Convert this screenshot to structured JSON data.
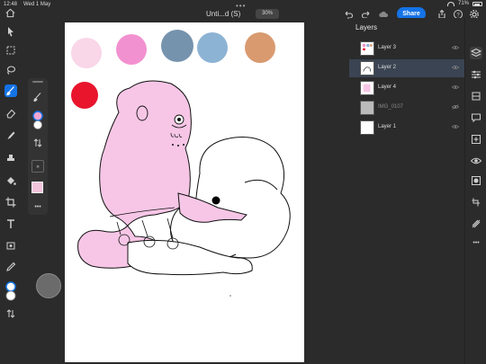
{
  "status": {
    "time": "12:48",
    "date": "Wed 1 May",
    "battery": "71%"
  },
  "header": {
    "doc_title": "Unti...d (S)",
    "zoom": "30%",
    "share_label": "Share"
  },
  "left_tools": [
    "pointer",
    "select",
    "lasso",
    "brush",
    "eraser",
    "smudge",
    "clone",
    "fill",
    "crop",
    "text",
    "type-transform",
    "eyedropper"
  ],
  "swatches": [
    "#f9d6e8",
    "#f291cf",
    "#7693ad",
    "#8db3d4",
    "#d99a70",
    "#e8152d"
  ],
  "layers": {
    "title": "Layers",
    "items": [
      {
        "name": "Layer 3",
        "selected": false,
        "dim": false
      },
      {
        "name": "Layer 2",
        "selected": true,
        "dim": false
      },
      {
        "name": "Layer 4",
        "selected": false,
        "dim": false
      },
      {
        "name": "IMG_0107",
        "selected": false,
        "dim": true
      },
      {
        "name": "Layer 1",
        "selected": false,
        "dim": false
      }
    ]
  },
  "icons": {
    "undo": "undo-icon",
    "redo": "redo-icon",
    "cloud": "cloud-icon",
    "export": "export-icon",
    "help": "help-icon",
    "settings": "settings-icon"
  }
}
